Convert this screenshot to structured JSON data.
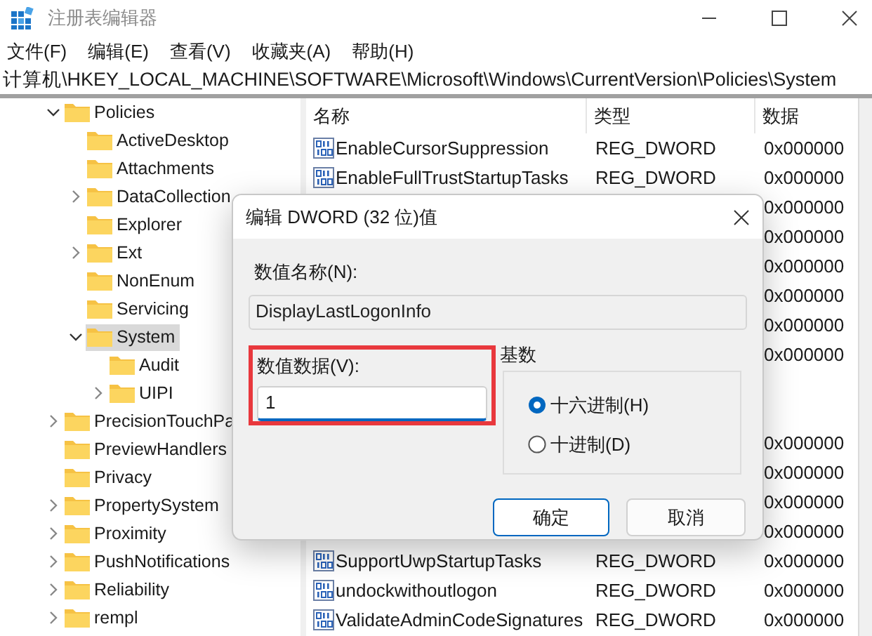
{
  "window": {
    "title": "注册表编辑器"
  },
  "menu": [
    "文件(F)",
    "编辑(E)",
    "查看(V)",
    "收藏夹(A)",
    "帮助(H)"
  ],
  "address": "计算机\\HKEY_LOCAL_MACHINE\\SOFTWARE\\Microsoft\\Windows\\CurrentVersion\\Policies\\System",
  "tree": [
    {
      "label": "Policies",
      "kind": "branch",
      "expanded": true,
      "selected": false,
      "children": [
        {
          "label": "ActiveDesktop",
          "kind": "leaf",
          "selected": false
        },
        {
          "label": "Attachments",
          "kind": "leaf",
          "selected": false
        },
        {
          "label": "DataCollection",
          "kind": "branch",
          "expanded": false,
          "selected": false
        },
        {
          "label": "Explorer",
          "kind": "leaf",
          "selected": false
        },
        {
          "label": "Ext",
          "kind": "branch",
          "expanded": false,
          "selected": false
        },
        {
          "label": "NonEnum",
          "kind": "leaf",
          "selected": false
        },
        {
          "label": "Servicing",
          "kind": "leaf",
          "selected": false
        },
        {
          "label": "System",
          "kind": "branch",
          "expanded": true,
          "selected": true,
          "children": [
            {
              "label": "Audit",
              "kind": "leaf",
              "selected": false
            },
            {
              "label": "UIPI",
              "kind": "branch",
              "expanded": false,
              "selected": false
            }
          ]
        }
      ]
    },
    {
      "label": "PrecisionTouchPa",
      "kind": "branch",
      "expanded": false,
      "selected": false
    },
    {
      "label": "PreviewHandlers",
      "kind": "leaf",
      "selected": false
    },
    {
      "label": "Privacy",
      "kind": "leaf",
      "selected": false
    },
    {
      "label": "PropertySystem",
      "kind": "branch",
      "expanded": false,
      "selected": false
    },
    {
      "label": "Proximity",
      "kind": "branch",
      "expanded": false,
      "selected": false
    },
    {
      "label": "PushNotifications",
      "kind": "branch",
      "expanded": false,
      "selected": false
    },
    {
      "label": "Reliability",
      "kind": "branch",
      "expanded": false,
      "selected": false
    },
    {
      "label": "rempl",
      "kind": "branch",
      "expanded": false,
      "selected": false
    }
  ],
  "table": {
    "columns": [
      "名称",
      "类型",
      "数据"
    ],
    "rows": [
      {
        "name": "EnableCursorSuppression",
        "type": "REG_DWORD",
        "data": "0x000000"
      },
      {
        "name": "EnableFullTrustStartupTasks",
        "type": "REG_DWORD",
        "data": "0x000000"
      },
      {
        "data": "0x000000"
      },
      {
        "data": "0x000000"
      },
      {
        "data": "0x000000"
      },
      {
        "data": "0x000000"
      },
      {
        "data": "0x000000"
      },
      {
        "data": "0x000000"
      },
      {},
      {},
      {
        "data": "0x000000"
      },
      {
        "data": "0x000000"
      },
      {
        "data": "0x000000"
      },
      {
        "data": "0x000000"
      },
      {
        "name": "SupportUwpStartupTasks",
        "type": "REG_DWORD",
        "data": "0x000000"
      },
      {
        "name": "undockwithoutlogon",
        "type": "REG_DWORD",
        "data": "0x000000"
      },
      {
        "name": "ValidateAdminCodeSignatures",
        "type": "REG_DWORD",
        "data": "0x000000"
      }
    ]
  },
  "dialog": {
    "title": "编辑 DWORD (32 位)值",
    "name_label": "数值名称(N):",
    "name_value": "DisplayLastLogonInfo",
    "data_label": "数值数据(V):",
    "data_value": "1",
    "base_label": "基数",
    "bases": [
      {
        "label": "十六进制(H)",
        "selected": true
      },
      {
        "label": "十进制(D)",
        "selected": false
      }
    ],
    "ok": "确定",
    "cancel": "取消"
  }
}
